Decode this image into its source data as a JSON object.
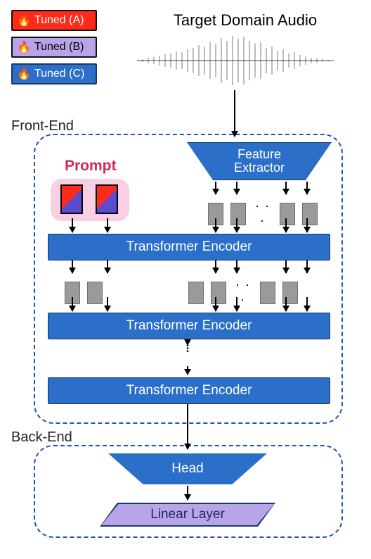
{
  "legend": {
    "a": "Tuned (A)",
    "b": "Tuned (B)",
    "c": "Tuned (C)"
  },
  "title": "Target Domain Audio",
  "sections": {
    "front": "Front-End",
    "back": "Back-End"
  },
  "prompt_label": "Prompt",
  "feature_extractor": {
    "line1": "Feature",
    "line2": "Extractor"
  },
  "encoder_label": "Transformer Encoder",
  "head_label": "Head",
  "linear_label": "Linear Layer",
  "ellipsis": ". . .",
  "vdots": "⋮",
  "fire": "🔥",
  "chart_data": {
    "type": "diagram",
    "title": "Prompt-tuning pipeline for domain adaptation of an audio model",
    "input": "Target Domain Audio waveform",
    "legend": [
      {
        "name": "Tuned (A)",
        "color": "#ff2a1a",
        "applies_to": [
          "Prompt tokens"
        ]
      },
      {
        "name": "Tuned (B)",
        "color": "#b9a4ea",
        "applies_to": [
          "Linear Layer"
        ]
      },
      {
        "name": "Tuned (C)",
        "color": "#2b6fc9",
        "applies_to": [
          "Feature Extractor",
          "Transformer Encoder",
          "Head"
        ]
      }
    ],
    "sections": [
      {
        "name": "Front-End",
        "blocks_in_order": [
          "Feature Extractor",
          "Prompt tokens (prepended to feature tokens)",
          "Transformer Encoder",
          "Transformer Encoder",
          "… (stack of encoders)",
          "Transformer Encoder"
        ],
        "prompt": {
          "num_tokens_shown": 2,
          "colors": [
            "#ff2a1a",
            "#5b4bd1"
          ],
          "highlighted": true
        }
      },
      {
        "name": "Back-End",
        "blocks_in_order": [
          "Head",
          "Linear Layer"
        ]
      }
    ],
    "flow": [
      "Target Domain Audio → Feature Extractor",
      "Feature Extractor → feature tokens",
      "Prompt tokens + feature tokens → Transformer Encoder × N",
      "Transformer Encoder output → Head",
      "Head → Linear Layer"
    ]
  }
}
